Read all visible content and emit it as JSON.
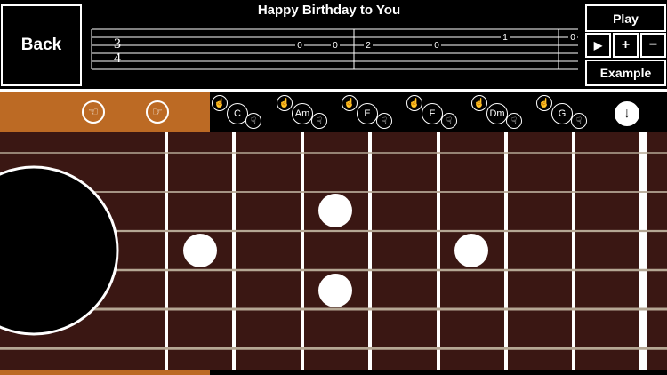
{
  "header": {
    "back_label": "Back",
    "song_title": "Happy Birthday to You",
    "play_label": "Play",
    "example_label": "Example",
    "small_play_icon": "▶",
    "plus_label": "+",
    "minus_label": "−"
  },
  "tab": {
    "time_sig_top": "3",
    "time_sig_bottom": "4",
    "notes": [
      {
        "text": "0",
        "string": 3
      },
      {
        "text": "0",
        "string": 3
      },
      {
        "text": "2",
        "string": 3
      },
      {
        "text": "0",
        "string": 3
      },
      {
        "text": "1",
        "string": 2
      },
      {
        "text": "0",
        "string": 2
      }
    ]
  },
  "chords": {
    "left_icons": [
      "hand-point-left-icon",
      "hand-point-right-icon"
    ],
    "items": [
      {
        "label": "C"
      },
      {
        "label": "Am"
      },
      {
        "label": "E"
      },
      {
        "label": "F"
      },
      {
        "label": "Dm"
      },
      {
        "label": "G"
      }
    ],
    "down_icon": "arrow-down-icon"
  },
  "colors": {
    "accent": "#bc6a24",
    "fretboard": "#3a1713",
    "fret": "#ffffff",
    "string": "#b5a794",
    "inlay": "#ffffff"
  }
}
